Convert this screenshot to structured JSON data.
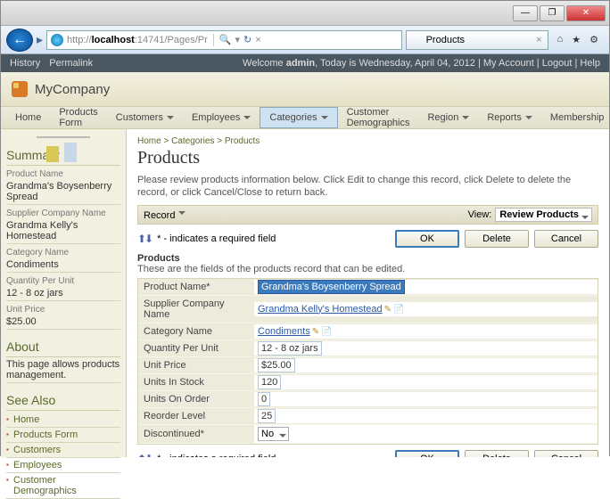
{
  "window": {
    "min": "—",
    "max": "❐",
    "close": "✕"
  },
  "nav": {
    "url_pre": "http://",
    "url_host": "localhost",
    "url_rest": ":14741/Pages/Pr",
    "search_icon": "🔍",
    "refresh_icon": "↻",
    "tab": "Products",
    "tabclose": "×",
    "home": "⌂",
    "star": "★",
    "gear": "⚙"
  },
  "status": {
    "history": "History",
    "permalink": "Permalink",
    "welcome": "Welcome ",
    "user": "admin",
    "today": ", Today is Wednesday, April 04, 2012",
    "myacc": "My Account",
    "logout": "Logout",
    "help": "Help"
  },
  "header": {
    "company": "MyCompany"
  },
  "menu": [
    "Home",
    "Products Form",
    "Customers",
    "Employees",
    "Categories",
    "Customer Demographics",
    "Region",
    "Reports",
    "Membership"
  ],
  "sidebar": {
    "summary": "Summary",
    "items": [
      {
        "label": "Product Name",
        "value": "Grandma's Boysenberry Spread"
      },
      {
        "label": "Supplier Company Name",
        "value": "Grandma Kelly's Homestead"
      },
      {
        "label": "Category Name",
        "value": "Condiments"
      },
      {
        "label": "Quantity Per Unit",
        "value": "12 - 8 oz jars"
      },
      {
        "label": "Unit Price",
        "value": "$25.00"
      }
    ],
    "about_h": "About",
    "about": "This page allows products management.",
    "seealso_h": "See Also",
    "seealso": [
      "Home",
      "Products Form",
      "Customers",
      "Employees",
      "Customer Demographics"
    ]
  },
  "main": {
    "bc": "Home > Categories > Products",
    "title": "Products",
    "instr": "Please review products information below. Click Edit to change this record, click Delete to delete the record, or click Cancel/Close to return back.",
    "record": "Record",
    "view_l": "View:",
    "view_v": "Review Products",
    "req": "* - indicates a required field",
    "ok": "OK",
    "delete": "Delete",
    "cancel": "Cancel",
    "sect": "Products",
    "sub": "These are the fields of the products record that can be edited.",
    "fields": {
      "pname_l": "Product Name*",
      "pname_v": "Grandma's Boysenberry Spread",
      "supp_l": "Supplier Company Name",
      "supp_v": "Grandma Kelly's Homestead",
      "cat_l": "Category Name",
      "cat_v": "Condiments",
      "qpu_l": "Quantity Per Unit",
      "qpu_v": "12 - 8 oz jars",
      "price_l": "Unit Price",
      "price_v": "$25.00",
      "stock_l": "Units In Stock",
      "stock_v": "120",
      "order_l": "Units On Order",
      "order_v": "0",
      "reorder_l": "Reorder Level",
      "reorder_v": "25",
      "disc_l": "Discontinued*",
      "disc_v": "No"
    }
  }
}
